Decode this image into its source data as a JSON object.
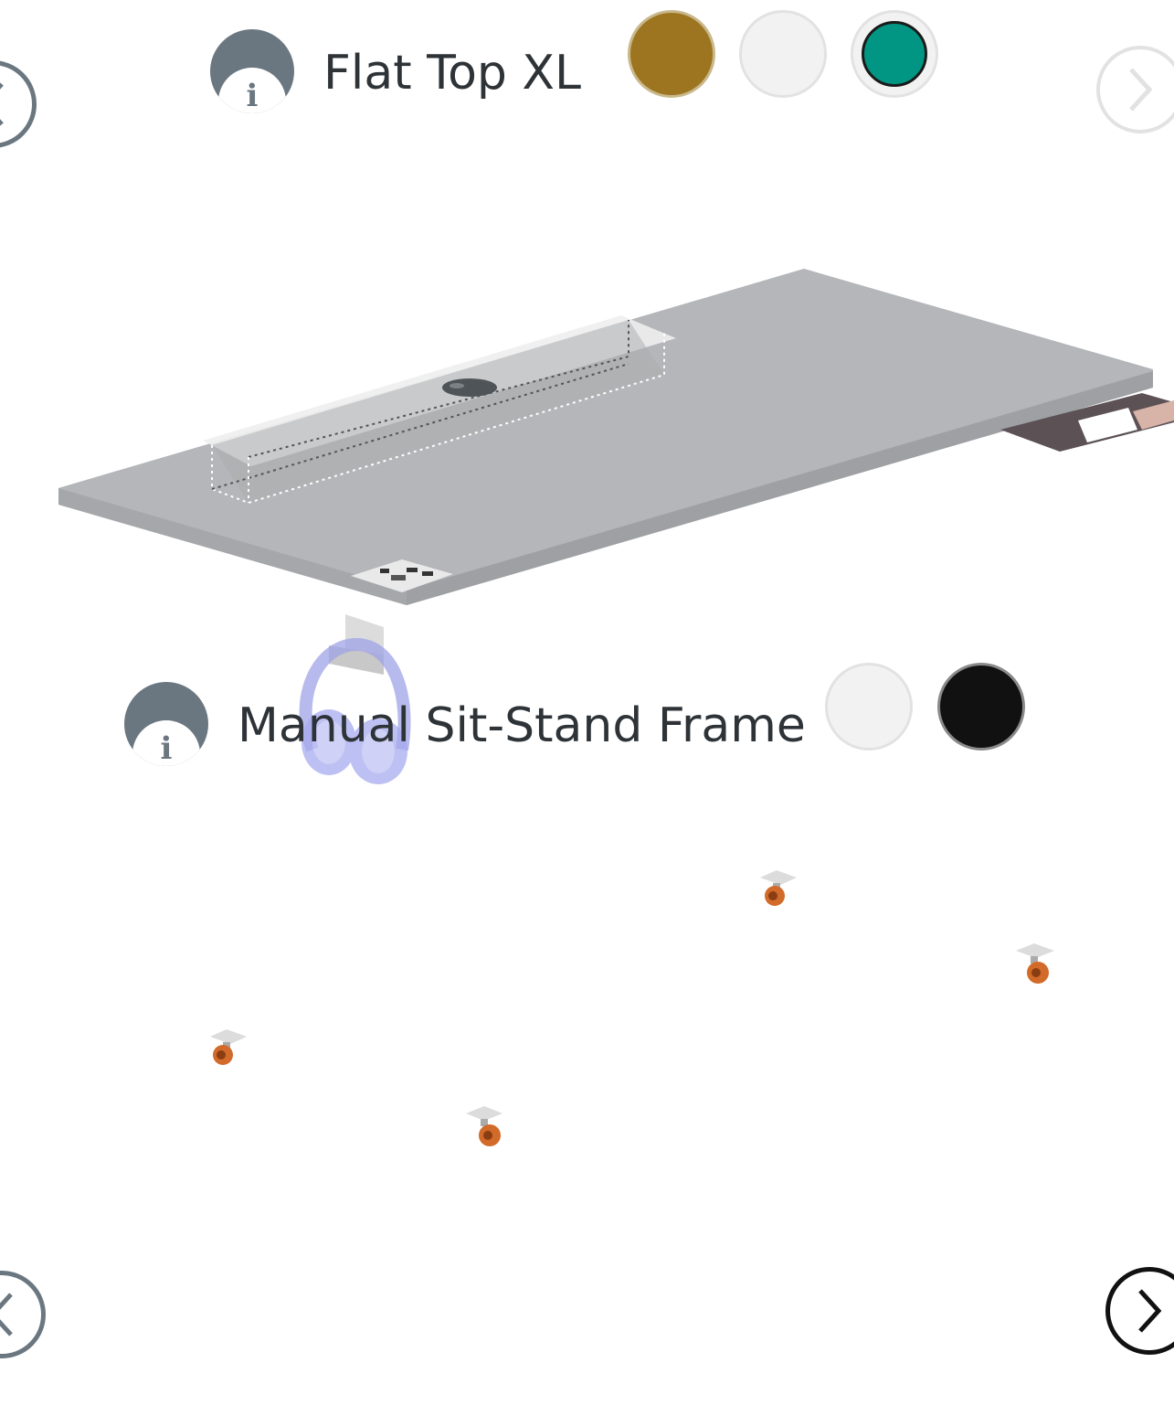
{
  "sections": [
    {
      "title": "Flat Top XL",
      "info_icon": "info-icon",
      "swatches": [
        {
          "name": "gold",
          "color": "#9d7520",
          "selected": false
        },
        {
          "name": "white",
          "color": "#f2f2f2",
          "selected": false
        },
        {
          "name": "teal",
          "color": "#009683",
          "selected": true
        }
      ]
    },
    {
      "title": "Manual Sit-Stand Frame",
      "info_icon": "info-icon",
      "swatches": [
        {
          "name": "white",
          "color": "#f2f2f2",
          "selected": false
        },
        {
          "name": "black",
          "color": "#111111",
          "selected": false
        }
      ]
    }
  ],
  "navigation": {
    "prev_icon": "chevron-left-icon",
    "next_icon": "chevron-right-icon"
  },
  "colors": {
    "icon_gray": "#6b7780",
    "desk_top": "#b3b5b8",
    "headphones": "#9fa3e6",
    "caster_orange": "#d26a2a"
  }
}
